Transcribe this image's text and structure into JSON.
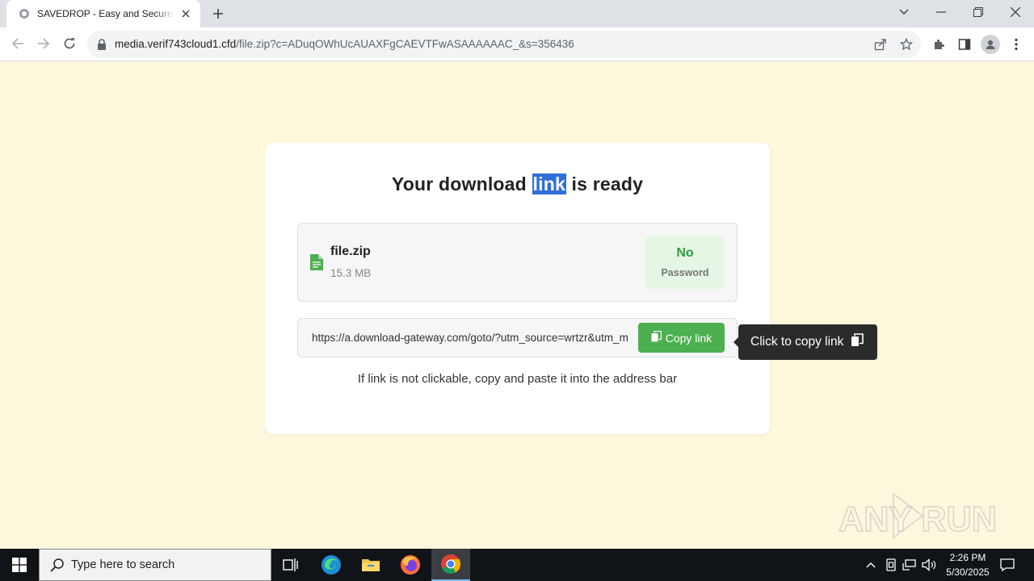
{
  "browser": {
    "tab_title": "SAVEDROP - Easy and Secure File",
    "url_host": "media.verif743cloud1.cfd",
    "url_path": "/file.zip?c=ADuqOWhUcAUAXFgCAEVTFwASAAAAAAC_&s=356436"
  },
  "page": {
    "headline_before": "Your download ",
    "headline_selected": "link",
    "headline_after": " is ready",
    "file_name": "file.zip",
    "file_size": "15.3 MB",
    "password_value": "No",
    "password_label": "Password",
    "download_link": "https://a.download-gateway.com/goto/?utm_source=wrtzr&utm_m",
    "copy_button_label": "Copy link",
    "tooltip": "Click to copy link",
    "hint": "If link is not clickable, copy and paste it into the address bar"
  },
  "taskbar": {
    "search_placeholder": "Type here to search",
    "time": "2:26 PM",
    "date": "5/30/2025"
  },
  "watermark": {
    "text": "ANY RUN"
  },
  "colors": {
    "page_background": "#fdf7dc",
    "accent_green": "#4caf50",
    "selection_blue": "#2f6fd6",
    "badge_green_bg": "#e6f6e5"
  }
}
